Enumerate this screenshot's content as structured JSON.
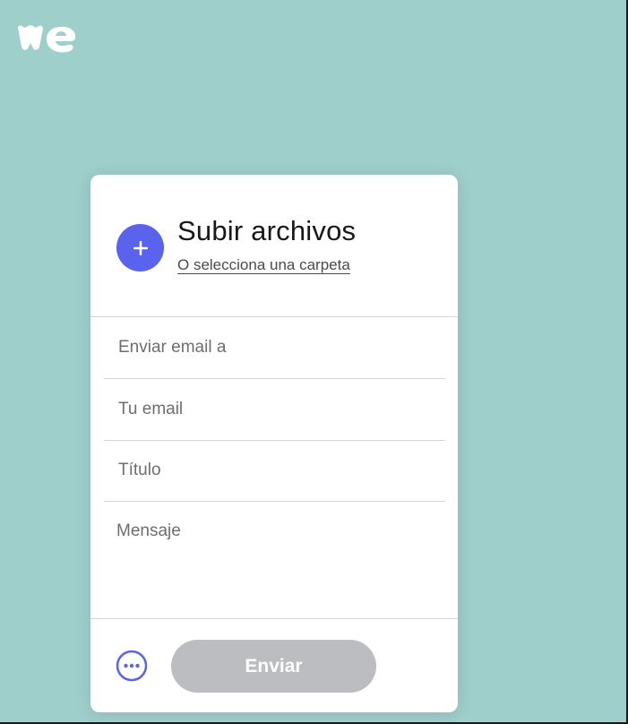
{
  "brand": {
    "logo_icon": "wetransfer-logo-icon"
  },
  "upload": {
    "add_icon": "plus-icon",
    "title": "Subir archivos",
    "folder_link": "O selecciona una carpeta"
  },
  "form": {
    "email_to_placeholder": "Enviar email a",
    "your_email_placeholder": "Tu email",
    "title_placeholder": "Título",
    "message_placeholder": "Mensaje"
  },
  "footer": {
    "more_icon": "more-options-icon",
    "send_label": "Enviar"
  },
  "colors": {
    "background": "#9fcfcb",
    "accent": "#5a63ee",
    "send_disabled": "#bcbdc0"
  }
}
